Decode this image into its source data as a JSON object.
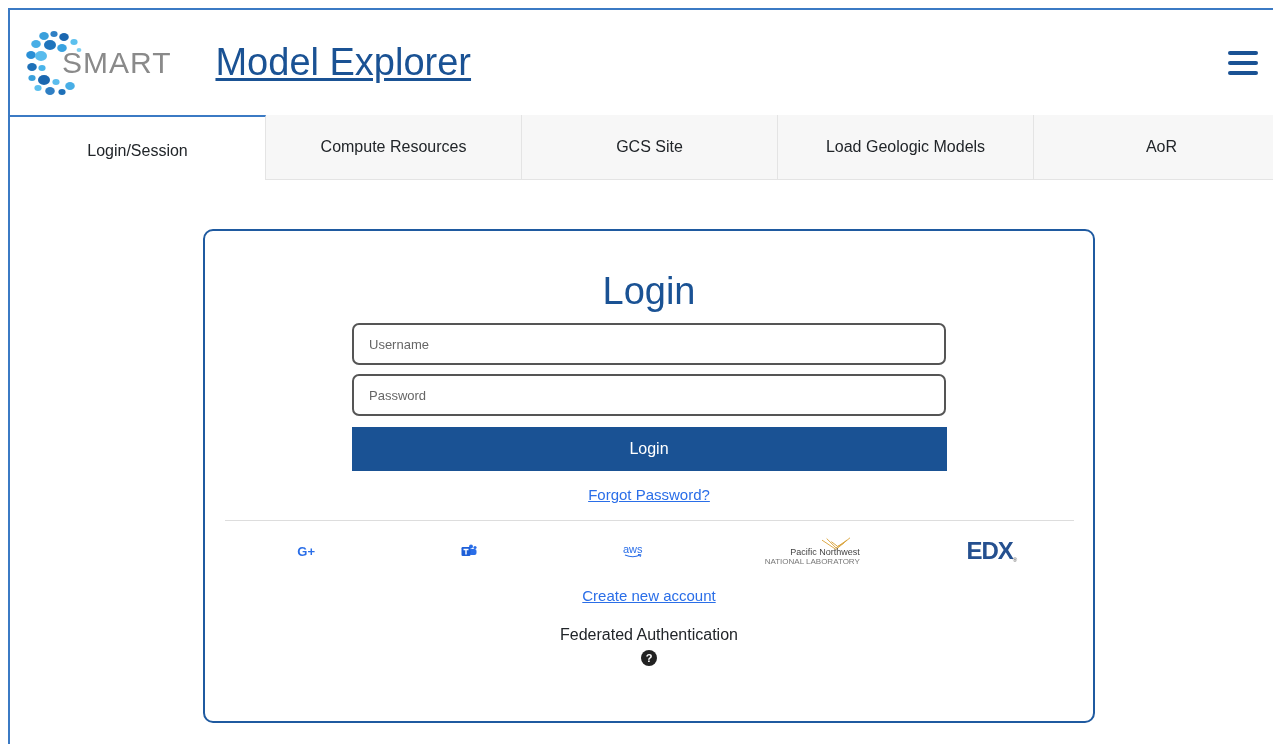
{
  "header": {
    "logo_text": "SMART",
    "title": "Model Explorer"
  },
  "tabs": [
    {
      "label": "Login/Session",
      "selected": true
    },
    {
      "label": "Compute Resources",
      "selected": false
    },
    {
      "label": "GCS Site",
      "selected": false
    },
    {
      "label": "Load Geologic Models",
      "selected": false
    },
    {
      "label": "AoR",
      "selected": false
    }
  ],
  "login": {
    "title": "Login",
    "username": {
      "placeholder": "Username"
    },
    "password": {
      "placeholder": "Password"
    },
    "button": "Login",
    "forgot_link": "Forgot Password?",
    "providers": [
      {
        "kind": "google",
        "text": "G+"
      },
      {
        "kind": "teams"
      },
      {
        "kind": "aws",
        "text": "aws"
      },
      {
        "kind": "pnnl",
        "text": "Pacific Northwest",
        "subtext": "NATIONAL LABORATORY"
      },
      {
        "kind": "edx",
        "text": "EDX",
        "mark": "®"
      }
    ],
    "create_link": "Create new account",
    "federated": "Federated Authentication",
    "help": "?"
  }
}
